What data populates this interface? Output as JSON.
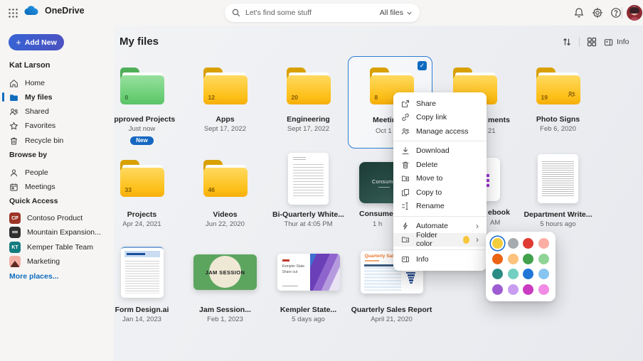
{
  "topbar": {
    "logo_text": "OneDrive",
    "search_placeholder": "Let's find some stuff",
    "search_scope": "All files"
  },
  "sidebar": {
    "add_new_label": "Add New",
    "user_name": "Kat Larson",
    "nav": [
      {
        "label": "Home"
      },
      {
        "label": "My files"
      },
      {
        "label": "Shared"
      },
      {
        "label": "Favorites"
      },
      {
        "label": "Recycle bin"
      }
    ],
    "browse_by_label": "Browse by",
    "browse": [
      {
        "label": "People"
      },
      {
        "label": "Meetings"
      }
    ],
    "quick_access_label": "Quick Access",
    "quick": [
      {
        "label": "Contoso Product",
        "initials": "CP",
        "color": "#9D3426"
      },
      {
        "label": "Mountain Expansion...",
        "initials": "",
        "color": "#2F2F2F"
      },
      {
        "label": "Kemper Table Team",
        "initials": "KT",
        "color": "#147C80"
      },
      {
        "label": "Marketing",
        "initials": "",
        "color": "#F2B0A6"
      }
    ],
    "more_places_label": "More places..."
  },
  "content": {
    "title": "My files",
    "info_label": "Info"
  },
  "files": {
    "approved": {
      "name": "Approved Projects",
      "date": "Just now",
      "count": "0",
      "badge": "New"
    },
    "apps": {
      "name": "Apps",
      "date": "Sept 17, 2022",
      "count": "12"
    },
    "engineering": {
      "name": "Engineering",
      "date": "Sept 17, 2022",
      "count": "20"
    },
    "meeting": {
      "name_fragment": "Meetin",
      "date_fragment": "Oct 1",
      "count": "8"
    },
    "ments": {
      "name_fragment": "ments",
      "date_fragment": "21",
      "count": ""
    },
    "photo_signs": {
      "name": "Photo Signs",
      "date": "Feb 6, 2020",
      "count": "19"
    },
    "projects": {
      "name": "Projects",
      "date": "Apr 24, 2021",
      "count": "33"
    },
    "videos": {
      "name": "Videos",
      "date": "Jun 22, 2020",
      "count": "46"
    },
    "biquarterly": {
      "name": "Bi-Quarterly White...",
      "date": "Thur at 4:05 PM"
    },
    "consumer": {
      "name_fragment": "Consumer",
      "date_fragment": "1 h",
      "thumb_text": "Consume"
    },
    "notebook": {
      "name_fragment": "ebook",
      "date_fragment": "AM"
    },
    "department": {
      "name": "Department Write...",
      "date": "5 hours ago"
    },
    "form_design": {
      "name": "Form Design.ai",
      "date": "Jan 14, 2023"
    },
    "jam": {
      "name": "Jam Session...",
      "date": "Feb 1, 2023",
      "thumb_text": "JAM SESSION"
    },
    "kempler": {
      "name": "Kempler State...",
      "date": "5 days ago",
      "thumb_line1": "Kempler State",
      "thumb_line2": "Share out"
    },
    "quarterly": {
      "name": "Quarterly Sales Report",
      "date": "April 21, 2020",
      "thumb_title": "Quarterly Sales"
    }
  },
  "menu": {
    "items": [
      "Share",
      "Copy link",
      "Manage access",
      "Download",
      "Delete",
      "Move to",
      "Copy to",
      "Rename",
      "Automate",
      "Folder color",
      "Info"
    ],
    "swatch_color": "#F6C73B"
  },
  "palette": {
    "colors": [
      "#F3CE3C",
      "#A6ABAF",
      "#E03B33",
      "#FBAEA4",
      "#EB6414",
      "#FCC27E",
      "#41A14D",
      "#90D496",
      "#2A8C84",
      "#72CFC1",
      "#2076D7",
      "#87C5F1",
      "#9E5CD3",
      "#C89DF0",
      "#C93BC0",
      "#F18BE5"
    ],
    "selected_index": 0
  }
}
